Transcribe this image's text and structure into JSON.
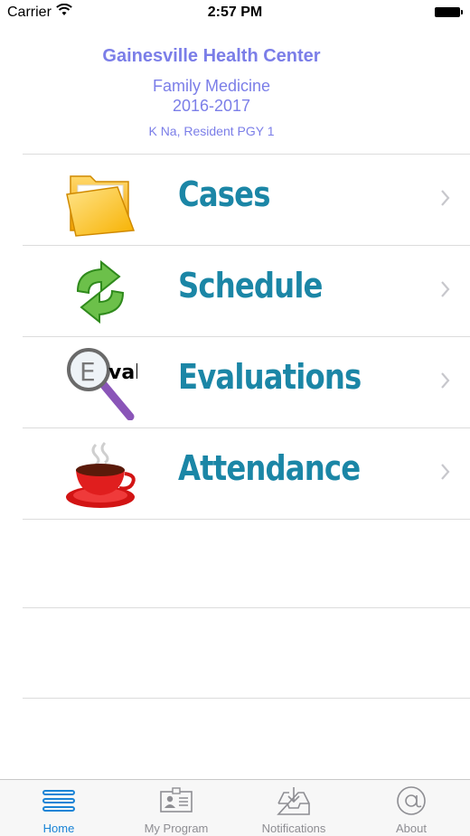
{
  "status_bar": {
    "carrier": "Carrier",
    "time": "2:57 PM"
  },
  "header": {
    "center_name": "Gainesville Health Center",
    "program": "Family Medicine",
    "year": "2016-2017",
    "resident": "K Na, Resident PGY  1"
  },
  "menu": {
    "items": [
      {
        "label": "Cases",
        "icon": "folder-icon"
      },
      {
        "label": "Schedule",
        "icon": "sync-arrows-icon"
      },
      {
        "label": "Evaluations",
        "icon": "magnifier-eval-icon"
      },
      {
        "label": "Attendance",
        "icon": "coffee-cup-icon"
      }
    ]
  },
  "tab_bar": {
    "tabs": [
      {
        "label": "Home",
        "icon": "menu-lines-icon",
        "active": true
      },
      {
        "label": "My Program",
        "icon": "id-card-icon",
        "active": false
      },
      {
        "label": "Notifications",
        "icon": "inbox-download-icon",
        "active": false
      },
      {
        "label": "About",
        "icon": "at-sign-icon",
        "active": false
      }
    ]
  },
  "colors": {
    "header_text": "#7b7ee8",
    "menu_label": "#1b86a6",
    "tab_active": "#1a84d6",
    "tab_inactive": "#8e8e93"
  }
}
